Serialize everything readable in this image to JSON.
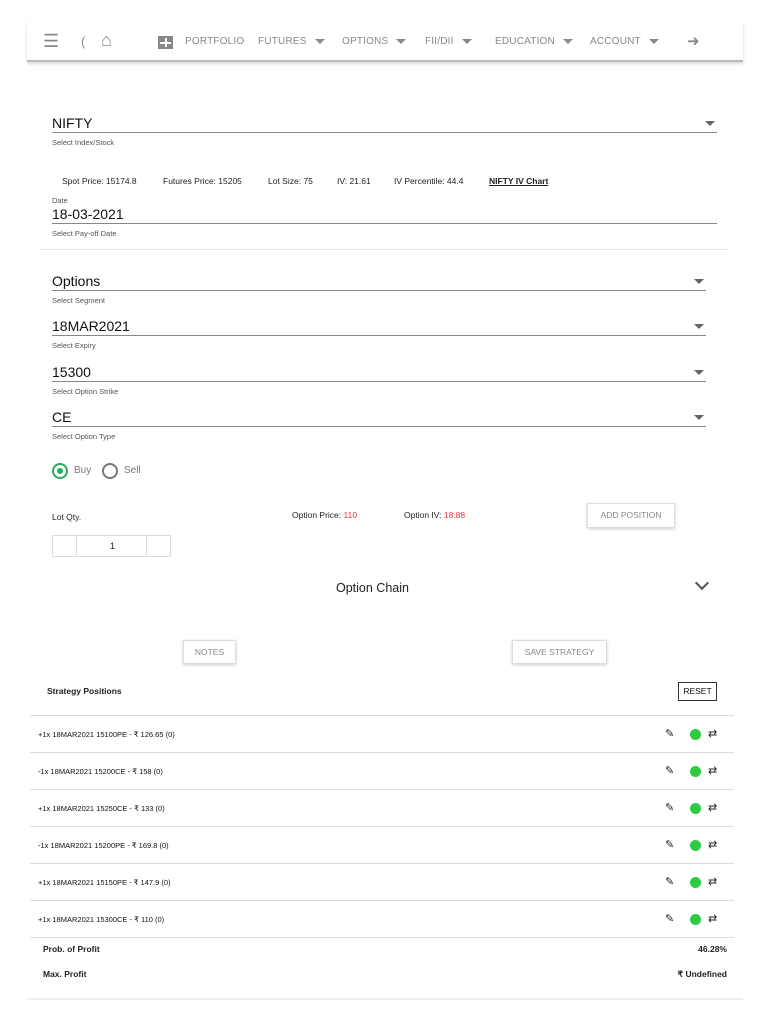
{
  "nav": {
    "items": [
      {
        "label": "PORTFOLIO"
      },
      {
        "label": "FUTURES"
      },
      {
        "label": "OPTIONS"
      },
      {
        "label": "FII/DII"
      },
      {
        "label": "EDUCATION"
      },
      {
        "label": "ACCOUNT"
      }
    ],
    "partial": "("
  },
  "index": {
    "value": "NIFTY",
    "helper": "Select Index/Stock"
  },
  "info": {
    "spot": "Spot Price: 15174.8",
    "futures": "Futures Price: 15205",
    "lot": "Lot Size: 75",
    "iv": "IV: 21.61",
    "ivp": "IV Percentile: 44.4",
    "chart_link": "NIFTY IV Chart"
  },
  "date": {
    "label": "Date",
    "value": "18-03-2021",
    "helper": "Select Pay-off Date"
  },
  "segment": {
    "value": "Options",
    "helper": "Select Segment"
  },
  "expiry": {
    "value": "18MAR2021",
    "helper": "Select Expiry"
  },
  "strike": {
    "value": "15300",
    "helper": "Select Option Strike"
  },
  "type": {
    "value": "CE",
    "helper": "Select Option Type"
  },
  "side": {
    "buy": "Buy",
    "sell": "Sell",
    "selected": "Buy"
  },
  "lot_qty": {
    "label": "Lot Qty.",
    "value": "1"
  },
  "option_price": {
    "label": "Option Price:",
    "value": "110"
  },
  "option_iv": {
    "label": "Option IV:",
    "value": "18.88"
  },
  "add_position": "ADD POSITION",
  "option_chain": "Option Chain",
  "notes": "NOTES",
  "save_strategy": "SAVE STRATEGY",
  "strategy": {
    "title": "Strategy Positions",
    "reset": "RESET",
    "positions": [
      {
        "text": "+1x  18MAR2021  15100PE  - ₹ 126.65  (0)"
      },
      {
        "text": "-1x  18MAR2021  15200CE  - ₹ 158  (0)"
      },
      {
        "text": "+1x  18MAR2021  15250CE  - ₹ 133  (0)"
      },
      {
        "text": "-1x  18MAR2021  15200PE  - ₹ 169.8  (0)"
      },
      {
        "text": "+1x  18MAR2021  15150PE  - ₹ 147.9  (0)"
      },
      {
        "text": "+1x  18MAR2021  15300CE  - ₹ 110  (0)"
      }
    ]
  },
  "summary": {
    "pop_label": "Prob. of Profit",
    "pop": "46.28%",
    "max_label": "Max. Profit",
    "max": "₹ Undefined"
  },
  "colors": {
    "accent_red": "#e53935",
    "green": "#2ecc40",
    "radio": "#27ae60"
  }
}
